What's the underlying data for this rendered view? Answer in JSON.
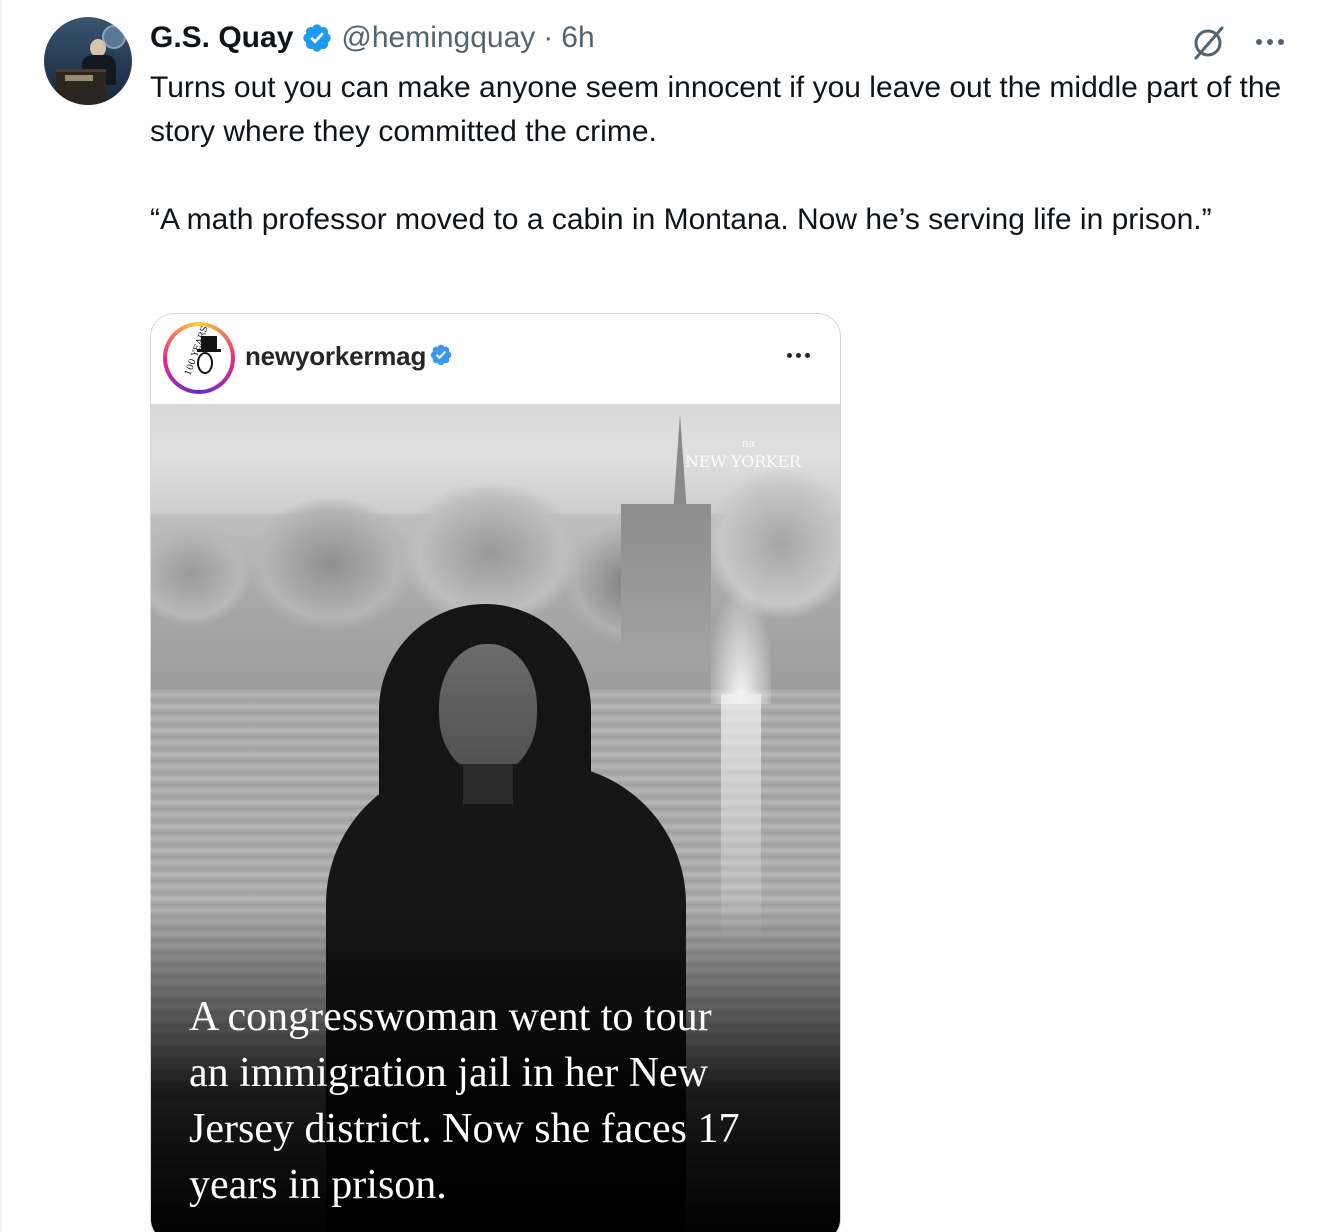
{
  "tweet": {
    "author_name": "G.S. Quay",
    "author_handle": "@hemingquay",
    "separator": "·",
    "time": "6h",
    "text_paragraphs": [
      "Turns out you can make anyone seem innocent if you leave out the middle part of the story where they committed the crime.",
      "“A math professor moved to a cabin in Montana. Now he’s serving life in prison.”"
    ],
    "icons": {
      "verified": "verified-badge-icon",
      "grok": "grok-icon",
      "more": "more-options-icon"
    },
    "colors": {
      "verified": "#1d9bf0",
      "secondary_text": "#536471",
      "text": "#0f1419",
      "border": "#cfd9de"
    }
  },
  "embedded_post": {
    "account_name": "newyorkermag",
    "avatar_text": "100 YEARS",
    "logo_text": "NEW YORKER",
    "logo_prefix": "THE",
    "caption": "A congresswoman went to tour\nan immigration jail in her New\nJersey district. Now she faces 17\nyears in prison."
  }
}
